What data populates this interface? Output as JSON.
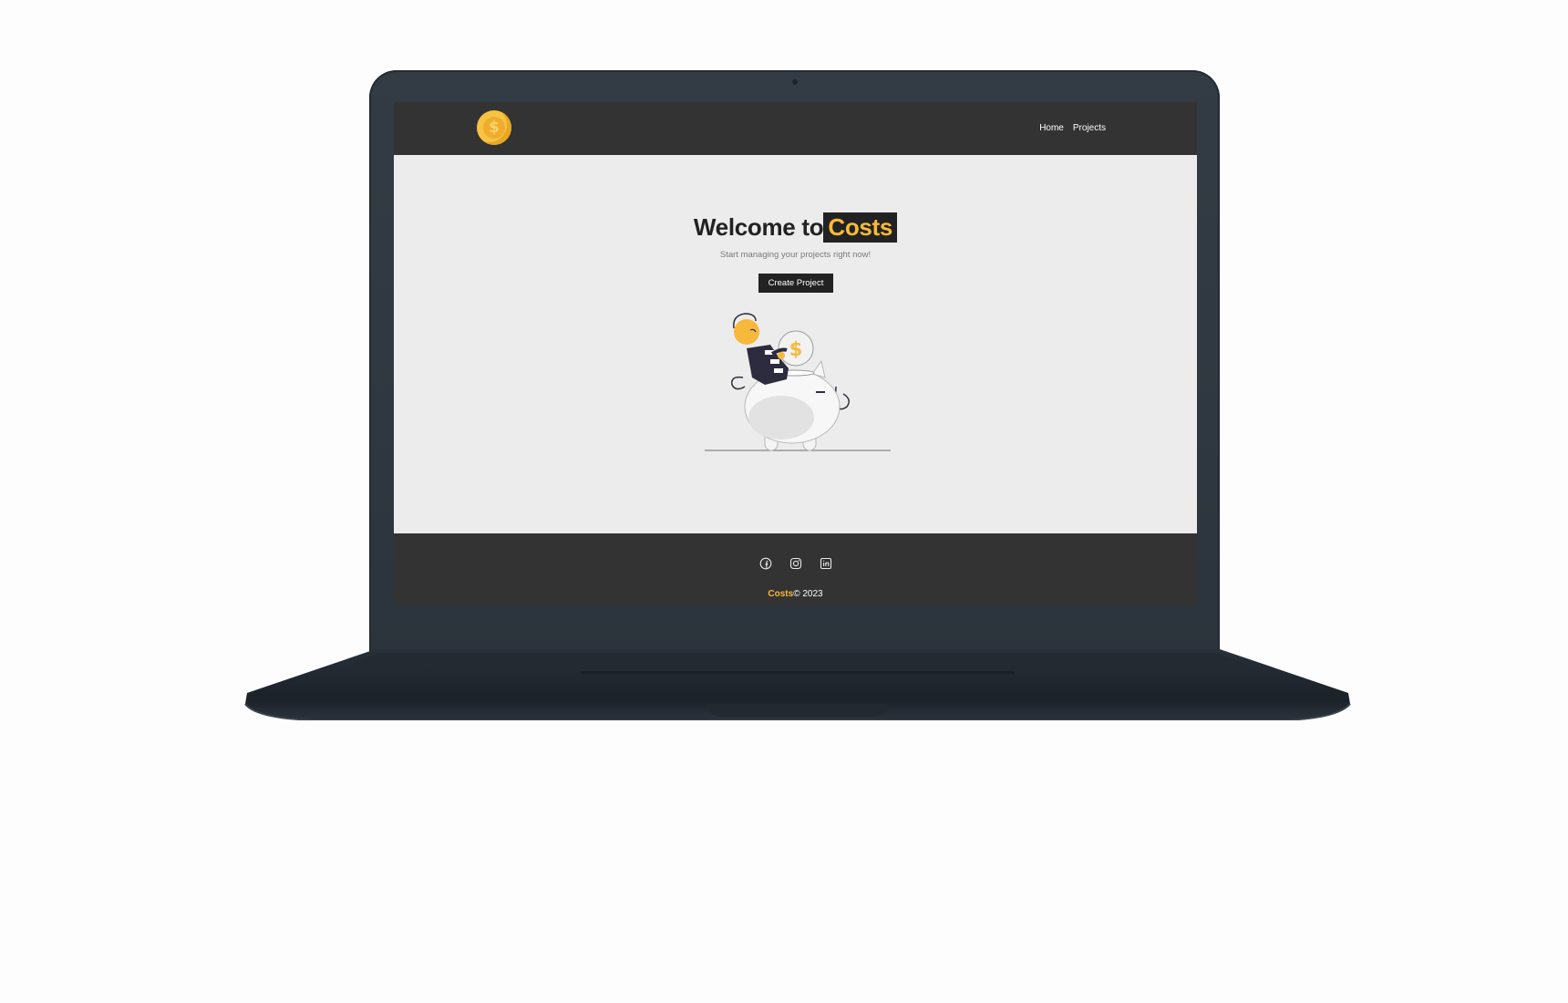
{
  "navbar": {
    "logo_icon": "dollar-coin-icon",
    "links": [
      {
        "label": "Home"
      },
      {
        "label": "Projects"
      }
    ]
  },
  "hero": {
    "title_prefix": "Welcome to",
    "title_highlight": "Costs",
    "subtitle": "Start managing your projects right now!",
    "button_label": "Create Project",
    "illustration": "piggy-bank-savings-illustration"
  },
  "footer": {
    "social_icons": [
      "facebook-icon",
      "instagram-icon",
      "linkedin-icon"
    ],
    "copyright_brand": "Costs",
    "copyright_rest": "© 2023"
  },
  "colors": {
    "accent": "#f6b93b",
    "dark": "#333333",
    "page_background": "#ececec",
    "laptop_body": "#2f3740"
  }
}
